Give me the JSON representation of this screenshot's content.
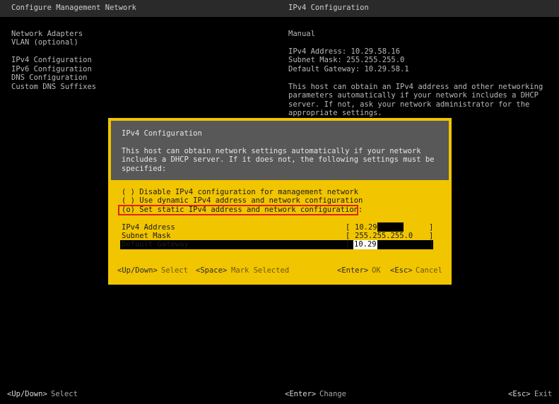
{
  "window": {
    "left_title": "Configure Management Network",
    "right_title": "IPv4 Configuration"
  },
  "menu": {
    "items": [
      "Network Adapters",
      "VLAN (optional)",
      "IPv4 Configuration",
      "IPv6 Configuration",
      "DNS Configuration",
      "Custom DNS Suffixes"
    ]
  },
  "info": {
    "mode": "Manual",
    "ipv4_address": "IPv4 Address: 10.29.58.16",
    "subnet_mask": "Subnet Mask: 255.255.255.0",
    "default_gateway": "Default Gateway: 10.29.58.1",
    "desc_lines": [
      "This host can obtain an IPv4 address and other networking",
      "parameters automatically if your network includes a DHCP",
      "server. If not, ask your network administrator for the",
      "appropriate settings."
    ]
  },
  "dialog": {
    "title": "IPv4 Configuration",
    "desc_lines": [
      "This host can obtain network settings automatically if your network",
      "includes a DHCP server. If it does not, the following settings must be",
      "specified:"
    ],
    "options": [
      "( ) Disable IPv4 configuration for management network",
      "( ) Use dynamic IPv4 address and network configuration",
      "(o) Set static IPv4 address and network configuration:"
    ],
    "fields": {
      "ip_label": "IPv4 Address",
      "ip_value": "10.29",
      "subnet_label": "Subnet Mask",
      "subnet_value": "255.255.255.0",
      "gateway_label": "Default Gateway",
      "gateway_value": "10.29"
    },
    "bracket_open": "[",
    "bracket_close": "]",
    "footer": {
      "updown_key": "<Up/Down>",
      "updown_action": "Select",
      "space_key": "<Space>",
      "space_action": "Mark Selected",
      "enter_key": "<Enter>",
      "enter_action": "OK",
      "esc_key": "<Esc>",
      "esc_action": "Cancel"
    }
  },
  "bottom": {
    "updown_key": "<Up/Down>",
    "updown_action": "Select",
    "enter_key": "<Enter>",
    "enter_action": "Change",
    "esc_key": "<Esc>",
    "esc_action": "Exit"
  },
  "colors": {
    "dialog_bg": "#f1c500",
    "dialog_header_bg": "#585858",
    "highlight_border": "#e0221b",
    "screen_bg": "#000000"
  }
}
